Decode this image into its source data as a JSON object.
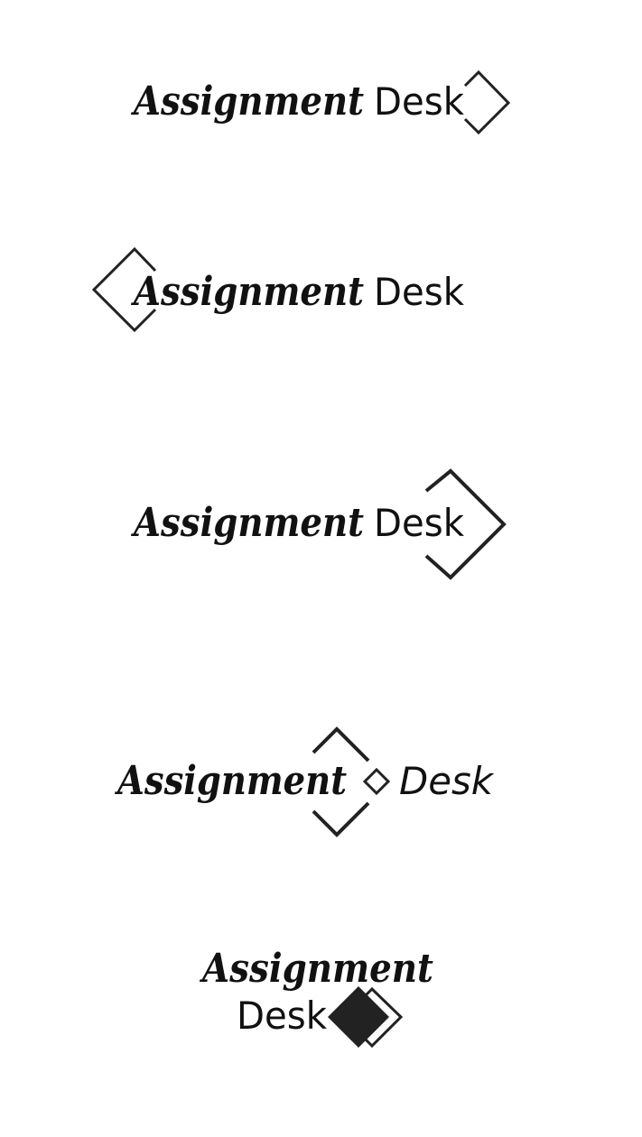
{
  "palette": {
    "ink": "#111111",
    "mark": "#222222",
    "background": "#ffffff"
  },
  "logos": [
    {
      "word1": "Assignment",
      "word2": "Desk",
      "mark": "outline-diamond-right"
    },
    {
      "word1": "Assignment",
      "word2": "Desk",
      "mark": "outline-diamond-left"
    },
    {
      "word1": "Assignment",
      "word2": "Desk",
      "mark": "large-chevron-diamond-right"
    },
    {
      "word1": "Assignment",
      "word2": "Desk",
      "mark": "split-diamond-center"
    },
    {
      "word1": "Assignment",
      "word2": "Desk",
      "mark": "filled-diamond-stacked"
    }
  ]
}
